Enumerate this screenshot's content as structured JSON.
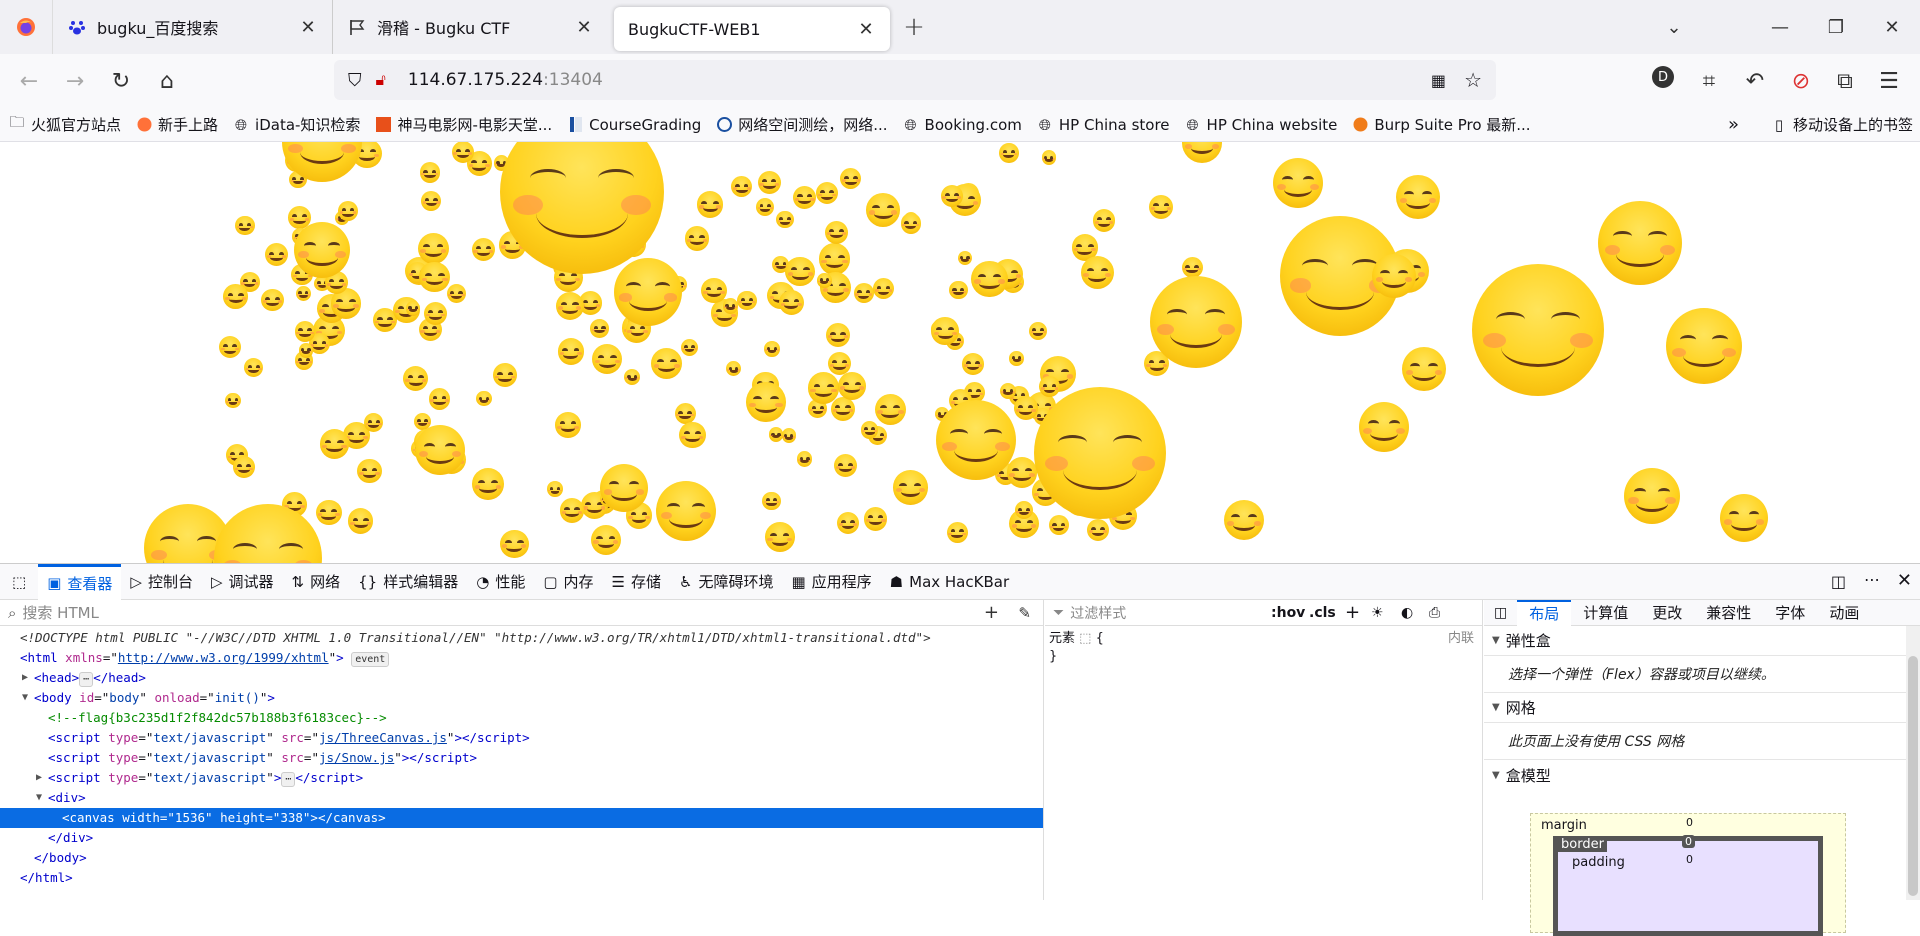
{
  "browser": {
    "tabs": [
      {
        "title": "bugku_百度搜索",
        "icon": "baidu-paw-icon"
      },
      {
        "title": "滑稽 - Bugku CTF",
        "icon": "flag-icon"
      },
      {
        "title": "BugkuCTF-WEB1",
        "icon": "none",
        "active": true
      }
    ],
    "url_host": "114.67.175.224",
    "url_port": ":13404",
    "profile_letter": "D",
    "bookmarks": [
      {
        "label": "火狐官方站点",
        "icon": "folder-icon"
      },
      {
        "label": "新手上路",
        "icon": "firefox-icon"
      },
      {
        "label": "iData-知识检索",
        "icon": "globe-icon"
      },
      {
        "label": "神马电影网-电影天堂...",
        "icon": "site-icon"
      },
      {
        "label": "CourseGrading",
        "icon": "site-icon"
      },
      {
        "label": "网络空间测绘，网络...",
        "icon": "site-icon"
      },
      {
        "label": "Booking.com",
        "icon": "globe-icon"
      },
      {
        "label": "HP China store",
        "icon": "globe-icon"
      },
      {
        "label": "HP China website",
        "icon": "globe-icon"
      },
      {
        "label": "Burp Suite Pro 最新...",
        "icon": "site-icon"
      }
    ],
    "mobile_bookmarks": "移动设备上的书签"
  },
  "devtools": {
    "tabs": [
      "查看器",
      "控制台",
      "调试器",
      "网络",
      "样式编辑器",
      "性能",
      "内存",
      "存储",
      "无障碍环境",
      "应用程序",
      "Max HacKBar"
    ],
    "search_placeholder": "搜索 HTML",
    "filter_placeholder": "过滤样式",
    "hov": ":hov",
    "cls": ".cls",
    "element_rule": "元素",
    "rule_open": "{",
    "rule_close": "}",
    "inline_label": "内联",
    "layout_tabs": [
      "布局",
      "计算值",
      "更改",
      "兼容性",
      "字体",
      "动画"
    ],
    "flex_title": "弹性盒",
    "flex_hint": "选择一个弹性（Flex）容器或项目以继续。",
    "grid_title": "网格",
    "grid_hint": "此页面上没有使用 CSS 网格",
    "boxmodel_title": "盒模型",
    "box": {
      "margin": "margin",
      "border": "border",
      "padding": "padding",
      "m": "0",
      "b": "0",
      "p": "0"
    },
    "html_lines": {
      "doctype": "<!DOCTYPE html PUBLIC \"-//W3C//DTD XHTML 1.0 Transitional//EN\" \"http://www.w3.org/TR/xhtml1/DTD/xhtml1-transitional.dtd\">",
      "html_open_tag": "<html",
      "html_attr": "xmlns",
      "html_val": "http://www.w3.org/1999/xhtml",
      "event_badge": "event",
      "head": "<head>",
      "head_close": "</head>",
      "body_open": "<body",
      "body_id": "body",
      "body_onload": "init()",
      "comment": "<!--flag{b3c235d1f2f842dc57b188b3f6183cec}-->",
      "script_src1": "js/ThreeCanvas.js",
      "script_src2": "js/Snow.js",
      "type_val": "text/javascript",
      "canvas_w": "1536",
      "canvas_h": "338"
    }
  }
}
